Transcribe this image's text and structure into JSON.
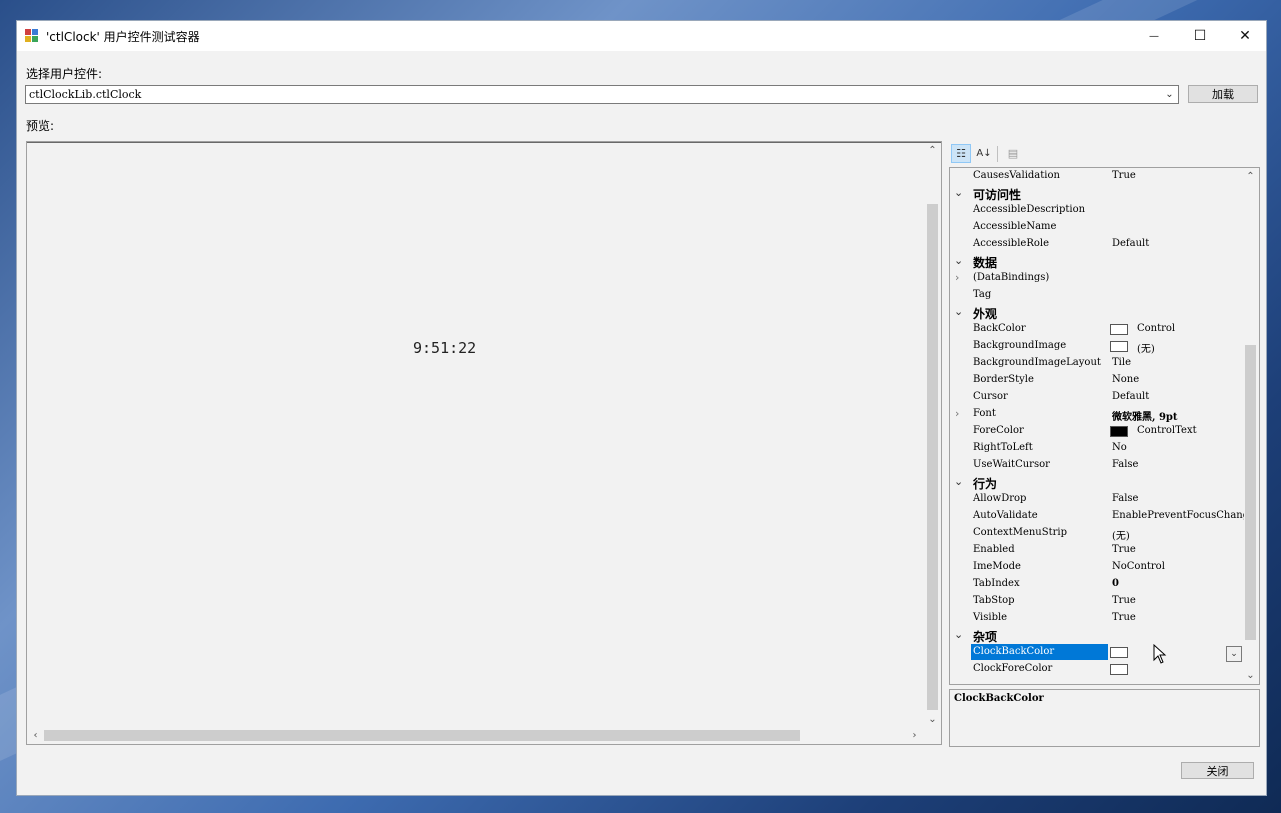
{
  "window": {
    "title": "'ctlClock' 用户控件测试容器",
    "minimize_glyph": "—",
    "maximize_glyph": "☐",
    "close_glyph": "✕"
  },
  "selector": {
    "label": "选择用户控件:",
    "value": "ctlClockLib.ctlClock",
    "load_label": "加载"
  },
  "preview": {
    "label": "预览:",
    "clock_text": "9:51:22"
  },
  "properties": {
    "rows": [
      {
        "type": "prop",
        "name": "CausesValidation",
        "value": "True"
      },
      {
        "type": "cat",
        "name": "可访问性"
      },
      {
        "type": "prop",
        "name": "AccessibleDescription",
        "value": ""
      },
      {
        "type": "prop",
        "name": "AccessibleName",
        "value": ""
      },
      {
        "type": "prop",
        "name": "AccessibleRole",
        "value": "Default"
      },
      {
        "type": "cat",
        "name": "数据"
      },
      {
        "type": "prop",
        "name": "(DataBindings)",
        "value": "",
        "expandable": true
      },
      {
        "type": "prop",
        "name": "Tag",
        "value": ""
      },
      {
        "type": "cat",
        "name": "外观"
      },
      {
        "type": "prop",
        "name": "BackColor",
        "value": "Control",
        "swatch": "#ffffff"
      },
      {
        "type": "prop",
        "name": "BackgroundImage",
        "value": "(无)",
        "swatch": "#ffffff"
      },
      {
        "type": "prop",
        "name": "BackgroundImageLayout",
        "value": "Tile"
      },
      {
        "type": "prop",
        "name": "BorderStyle",
        "value": "None"
      },
      {
        "type": "prop",
        "name": "Cursor",
        "value": "Default"
      },
      {
        "type": "prop",
        "name": "Font",
        "value": "微软雅黑, 9pt",
        "expandable": true,
        "bold": true
      },
      {
        "type": "prop",
        "name": "ForeColor",
        "value": "ControlText",
        "swatch": "#000000"
      },
      {
        "type": "prop",
        "name": "RightToLeft",
        "value": "No"
      },
      {
        "type": "prop",
        "name": "UseWaitCursor",
        "value": "False"
      },
      {
        "type": "cat",
        "name": "行为"
      },
      {
        "type": "prop",
        "name": "AllowDrop",
        "value": "False"
      },
      {
        "type": "prop",
        "name": "AutoValidate",
        "value": "EnablePreventFocusChange"
      },
      {
        "type": "prop",
        "name": "ContextMenuStrip",
        "value": "(无)"
      },
      {
        "type": "prop",
        "name": "Enabled",
        "value": "True"
      },
      {
        "type": "prop",
        "name": "ImeMode",
        "value": "NoControl"
      },
      {
        "type": "prop",
        "name": "TabIndex",
        "value": "0",
        "bold": true
      },
      {
        "type": "prop",
        "name": "TabStop",
        "value": "True"
      },
      {
        "type": "prop",
        "name": "Visible",
        "value": "True"
      },
      {
        "type": "cat",
        "name": "杂项"
      },
      {
        "type": "prop",
        "name": "ClockBackColor",
        "value": "",
        "swatch": "#ffffff",
        "selected": true
      },
      {
        "type": "prop",
        "name": "ClockForeColor",
        "value": "",
        "swatch": "#ffffff"
      }
    ],
    "description_title": "ClockBackColor"
  },
  "footer": {
    "close_label": "关闭"
  },
  "icons": {
    "categorized": "categorized-icon",
    "alphabetical": "sort-alpha-icon",
    "property_pages": "property-pages-icon"
  },
  "colors": {
    "selection": "#0078d7",
    "window_bg": "#f2f2f2"
  }
}
